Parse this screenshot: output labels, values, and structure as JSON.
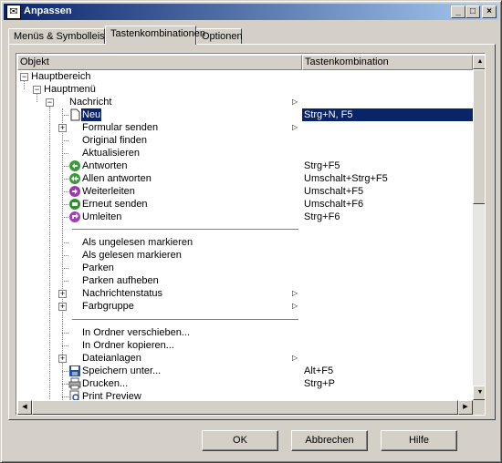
{
  "window": {
    "title": "Anpassen",
    "controls": {
      "minimize": "_",
      "maximize": "□",
      "close": "×"
    }
  },
  "tabs": [
    {
      "label": "Menüs & Symbolleisten",
      "active": false
    },
    {
      "label": "Tastenkombinationen",
      "active": true
    },
    {
      "label": "Optionen",
      "active": false
    }
  ],
  "list": {
    "columns": {
      "object": "Objekt",
      "shortcut": "Tastenkombination"
    },
    "rows": [
      {
        "label": "Hauptbereich",
        "shortcut": ""
      },
      {
        "label": "Hauptmenü",
        "shortcut": ""
      },
      {
        "label": "Nachricht",
        "shortcut": "",
        "submenu": true
      },
      {
        "label": "Neu",
        "shortcut": "Strg+N, F5",
        "selected": true
      },
      {
        "label": "Formular senden",
        "shortcut": "",
        "submenu": true
      },
      {
        "label": "Original finden",
        "shortcut": ""
      },
      {
        "label": "Aktualisieren",
        "shortcut": ""
      },
      {
        "label": "Antworten",
        "shortcut": "Strg+F5"
      },
      {
        "label": "Allen antworten",
        "shortcut": "Umschalt+Strg+F5"
      },
      {
        "label": "Weiterleiten",
        "shortcut": "Umschalt+F5"
      },
      {
        "label": "Erneut senden",
        "shortcut": "Umschalt+F6"
      },
      {
        "label": "Umleiten",
        "shortcut": "Strg+F6"
      },
      {
        "label": "Als ungelesen markieren",
        "shortcut": ""
      },
      {
        "label": "Als gelesen markieren",
        "shortcut": ""
      },
      {
        "label": "Parken",
        "shortcut": ""
      },
      {
        "label": "Parken aufheben",
        "shortcut": ""
      },
      {
        "label": "Nachrichtenstatus",
        "shortcut": "",
        "submenu": true
      },
      {
        "label": "Farbgruppe",
        "shortcut": "",
        "submenu": true
      },
      {
        "label": "In Ordner verschieben...",
        "shortcut": ""
      },
      {
        "label": "In Ordner kopieren...",
        "shortcut": ""
      },
      {
        "label": "Dateianlagen",
        "shortcut": "",
        "submenu": true
      },
      {
        "label": "Speichern unter...",
        "shortcut": "Alt+F5"
      },
      {
        "label": "Drucken...",
        "shortcut": "Strg+P"
      },
      {
        "label": "Print Preview",
        "shortcut": ""
      }
    ]
  },
  "buttons": {
    "ok": "OK",
    "cancel": "Abbrechen",
    "help": "Hilfe"
  },
  "icons": {
    "app": "app-icon",
    "new": "new-document-icon",
    "reply": "reply-icon",
    "reply_all": "reply-all-icon",
    "forward": "forward-icon",
    "resend": "resend-icon",
    "redirect": "redirect-icon",
    "save": "save-disk-icon",
    "print": "printer-icon",
    "preview": "print-preview-icon"
  },
  "colors": {
    "selection": "#0a246a",
    "titlebar_start": "#0a246a",
    "titlebar_end": "#a6caf0",
    "face": "#d4d0c8"
  }
}
